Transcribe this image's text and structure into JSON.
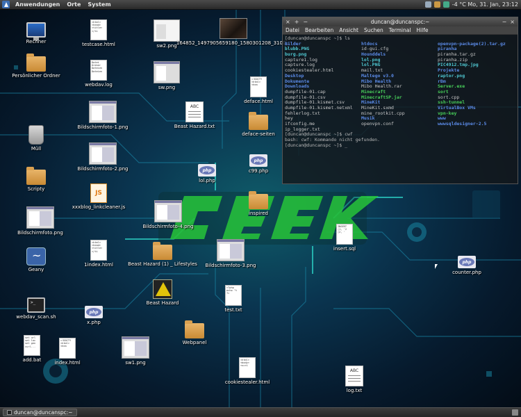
{
  "top_panel": {
    "menus": [
      "Anwendungen",
      "Orte",
      "System"
    ],
    "status": "-4 °C  Mo, 31. Jan, 23:12"
  },
  "bottom_panel": {
    "task_label": "duncan@duncanspc:~"
  },
  "terminal": {
    "title": "duncan@duncanspc:~",
    "menu": [
      "Datei",
      "Bearbeiten",
      "Ansicht",
      "Suchen",
      "Terminal",
      "Hilfe"
    ],
    "prompt": "[duncan@duncanspc ~]$ ls",
    "col1": [
      "Bilder",
      "blubb.PNG",
      "burg.png",
      "capture1.log",
      "capture.log",
      "cookiestealer.html",
      "Desktop",
      "Dokumente",
      "Downloads",
      "dumpfile-01.cap",
      "dumpfile-01.csv",
      "dumpfile-01.kismet.csv",
      "dumpfile-01.kismet.netxml",
      "fehlerlog.txt",
      "hey",
      "ifconfig.me",
      "ip_logger.txt"
    ],
    "col2": [
      "htdocs",
      "id-gui.cfg",
      "Hounddels",
      "lol.png",
      "lol.PNG",
      "mail.txt",
      "Maltego v3.0",
      "Mibo Health",
      "Mibo Health.rar",
      "Minecraft",
      "MinecraftSP.jar",
      "MineKit",
      "MineKit.sxmd",
      "mine_rootkit.cpp",
      "Musik",
      "openvpn.conf"
    ],
    "col3": [
      "openvpn-package(2).tar.gz",
      "piranha",
      "piranha.tar.gz",
      "piranha.zip",
      "PIC4912.tmp.jpg",
      "Projekte",
      "raptor.png",
      "rBm",
      "Server.exe",
      "sort",
      "sort.cpp",
      "ssh-tunnel",
      "VirtualBox VMs",
      "vpn-key",
      "www",
      "wwwsqldesigner-2.5"
    ],
    "tail": [
      "[duncan@duncanspc ~]$ cwf",
      "bash: cwf: Kommando nicht gefunden.",
      "[duncan@duncanspc ~]$ _"
    ]
  },
  "icons": {
    "rechner": "Rechner",
    "persoenlicher": "Persönlicher Ordner",
    "muell": "Müll",
    "scripty": "Scripty",
    "bildschirmfoto": "Bildschirmfoto.png",
    "geany": "Geany",
    "webdav_scan": "webdav_scan.sh",
    "add_bat": "add.bat",
    "testcase": "testcase.html",
    "webdavlog": "webdav.log",
    "bf1": "Bildschirmfoto-1.png",
    "bf2": "Bildschirmfoto-2.png",
    "xxxblog": "xxxblog_linkcleaner.js",
    "index1": "1index.html",
    "xphp": "x.php",
    "index": "index.html",
    "sw2": "sw2.png",
    "sw": "sw.png",
    "photo": "164852_1497905659180_1580301208_3100...",
    "beasthazard_txt": "Beast Hazard.txt",
    "defacedaten": "deface.html",
    "defaceseiten": "deface-seiten",
    "lolphp": "lol.php",
    "c99": "c99.php",
    "inspired": "inspired",
    "bf4": "Bildschirmfoto-4.png",
    "beasthazard_folder": "Beast Hazard (1) _ Lifestyles",
    "bf3": "Bildschirmfoto-3.png",
    "beast_hazard": "Beast Hazard",
    "testtxt": "test.txt",
    "webpanel": "Webpanel",
    "sw1": "sw1.png",
    "cookiestealer": "cookiestealer.html",
    "insql": "insert.sql",
    "counter": "counter.php",
    "logtxt": "log.txt"
  }
}
